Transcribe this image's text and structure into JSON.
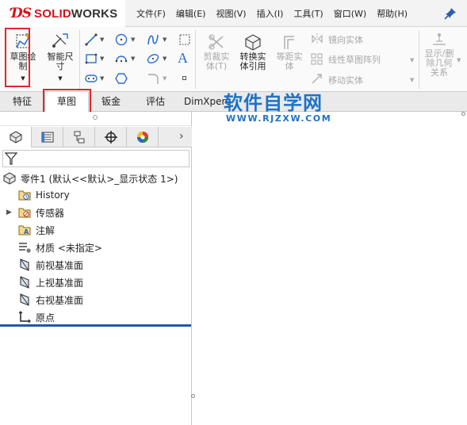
{
  "app": {
    "brand_prefix": "SOLID",
    "brand_suffix": "WORKS"
  },
  "menu": [
    {
      "label": "文件(F)"
    },
    {
      "label": "编辑(E)"
    },
    {
      "label": "视图(V)"
    },
    {
      "label": "插入(I)"
    },
    {
      "label": "工具(T)"
    },
    {
      "label": "窗口(W)"
    },
    {
      "label": "帮助(H)"
    }
  ],
  "ribbon": {
    "sketch_label_1": "草图绘",
    "sketch_label_2": "制",
    "smart_dim_label_1": "智能尺",
    "smart_dim_label_2": "寸",
    "trim_label_1": "剪裁实",
    "trim_label_2": "体(T)",
    "convert_label_1": "转换实",
    "convert_label_2": "体引用",
    "offset_label_1": "等距实",
    "offset_label_2": "体",
    "mirror_label": "镜向实体",
    "linear_pattern_label": "线性草图阵列",
    "move_label": "移动实体",
    "show_hide_label_1": "显示/删",
    "show_hide_label_2": "除几何",
    "show_hide_label_3": "关系"
  },
  "tabs": [
    {
      "label": "特征"
    },
    {
      "label": "草图"
    },
    {
      "label": "钣金"
    },
    {
      "label": "评估"
    },
    {
      "label": "DimXpert"
    }
  ],
  "watermark": {
    "main": "软件自学网",
    "sub": "WWW.RJZXW.COM"
  },
  "tree": {
    "root": "零件1  (默认<<默认>_显示状态 1>)",
    "items": [
      {
        "label": "History"
      },
      {
        "label": "传感器"
      },
      {
        "label": "注解"
      },
      {
        "label": "材质 <未指定>"
      },
      {
        "label": "前视基准面"
      },
      {
        "label": "上视基准面"
      },
      {
        "label": "右视基准面"
      },
      {
        "label": "原点"
      }
    ]
  },
  "colors": {
    "brand_red": "#d8101a",
    "highlight_red": "#e3262b",
    "watermark_blue": "#1e72c6",
    "tree_end_line": "#1f5aa6"
  }
}
